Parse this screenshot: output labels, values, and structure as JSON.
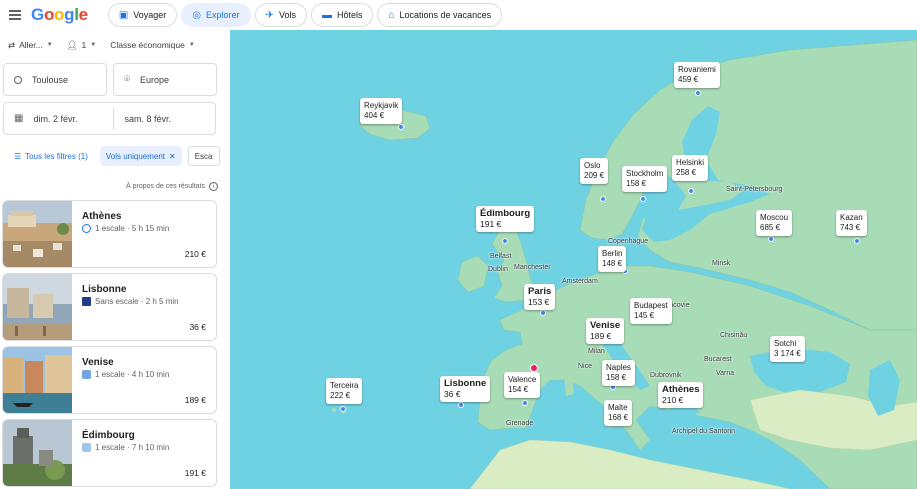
{
  "header": {
    "logo": "Google",
    "tabs": [
      {
        "label": "Voyager",
        "icon": "suitcase-icon",
        "active": false
      },
      {
        "label": "Explorer",
        "icon": "explore-icon",
        "active": true
      },
      {
        "label": "Vols",
        "icon": "plane-icon",
        "active": false
      },
      {
        "label": "Hôtels",
        "icon": "bed-icon",
        "active": false
      },
      {
        "label": "Locations de vacances",
        "icon": "house-icon",
        "active": false
      }
    ]
  },
  "search": {
    "trip_type": "Aller...",
    "passengers": "1",
    "cabin": "Classe économique",
    "origin": "Toulouse",
    "destination": "Europe",
    "depart_date": "dim. 2 févr.",
    "return_date": "sam. 8 févr."
  },
  "filters": {
    "all_filters": "Tous les filtres (1)",
    "flights_only": "Vols uniquement",
    "stops": "Esca"
  },
  "results_about": "À propos de ces résultats",
  "results": [
    {
      "city": "Athènes",
      "route": "1 escale · 5 h 15 min",
      "price": "210 €",
      "airline_color": "#1a73e8"
    },
    {
      "city": "Lisbonne",
      "route": "Sans escale · 2 h 5 min",
      "price": "36 €",
      "airline_color": "#1f3c88"
    },
    {
      "city": "Venise",
      "route": "1 escale · 4 h 10 min",
      "price": "189 €",
      "airline_color": "#6fa8dc"
    },
    {
      "city": "Édimbourg",
      "route": "1 escale · 7 h 10 min",
      "price": "191 €",
      "airline_color": "#9fc5e8"
    }
  ],
  "map": {
    "price_pins": [
      {
        "city": "Reykjavik",
        "price": "404 €",
        "big": false
      },
      {
        "city": "Rovaniemi",
        "price": "459 €",
        "big": false
      },
      {
        "city": "Oslo",
        "price": "209 €",
        "big": false
      },
      {
        "city": "Stockholm",
        "price": "158 €",
        "big": false
      },
      {
        "city": "Helsinki",
        "price": "258 €",
        "big": false
      },
      {
        "city": "Édimbourg",
        "price": "191 €",
        "big": true
      },
      {
        "city": "Moscou",
        "price": "685 €",
        "big": false
      },
      {
        "city": "Kazan",
        "price": "743 €",
        "big": false
      },
      {
        "city": "Berlin",
        "price": "148 €",
        "big": false
      },
      {
        "city": "Paris",
        "price": "153 €",
        "big": true
      },
      {
        "city": "Budapest",
        "price": "145 €",
        "big": false
      },
      {
        "city": "Venise",
        "price": "189 €",
        "big": true
      },
      {
        "city": "Sotchi",
        "price": "3 174 €",
        "big": false
      },
      {
        "city": "Terceira",
        "price": "222 €",
        "big": false
      },
      {
        "city": "Lisbonne",
        "price": "36 €",
        "big": true
      },
      {
        "city": "Valence",
        "price": "154 €",
        "big": false
      },
      {
        "city": "Naples",
        "price": "158 €",
        "big": false
      },
      {
        "city": "Athènes",
        "price": "210 €",
        "big": true
      },
      {
        "city": "Malte",
        "price": "168 €",
        "big": false
      }
    ],
    "city_labels": [
      "Saint-Pétersbourg",
      "Copenhague",
      "Belfast",
      "Dublin",
      "Manchester",
      "Amsterdam",
      "Minsk",
      "Cracovie",
      "Chisinău",
      "Milan",
      "Nice",
      "Bucarest",
      "Varna",
      "Dubrovnik",
      "Grenade",
      "Archipel du Santorin"
    ]
  }
}
